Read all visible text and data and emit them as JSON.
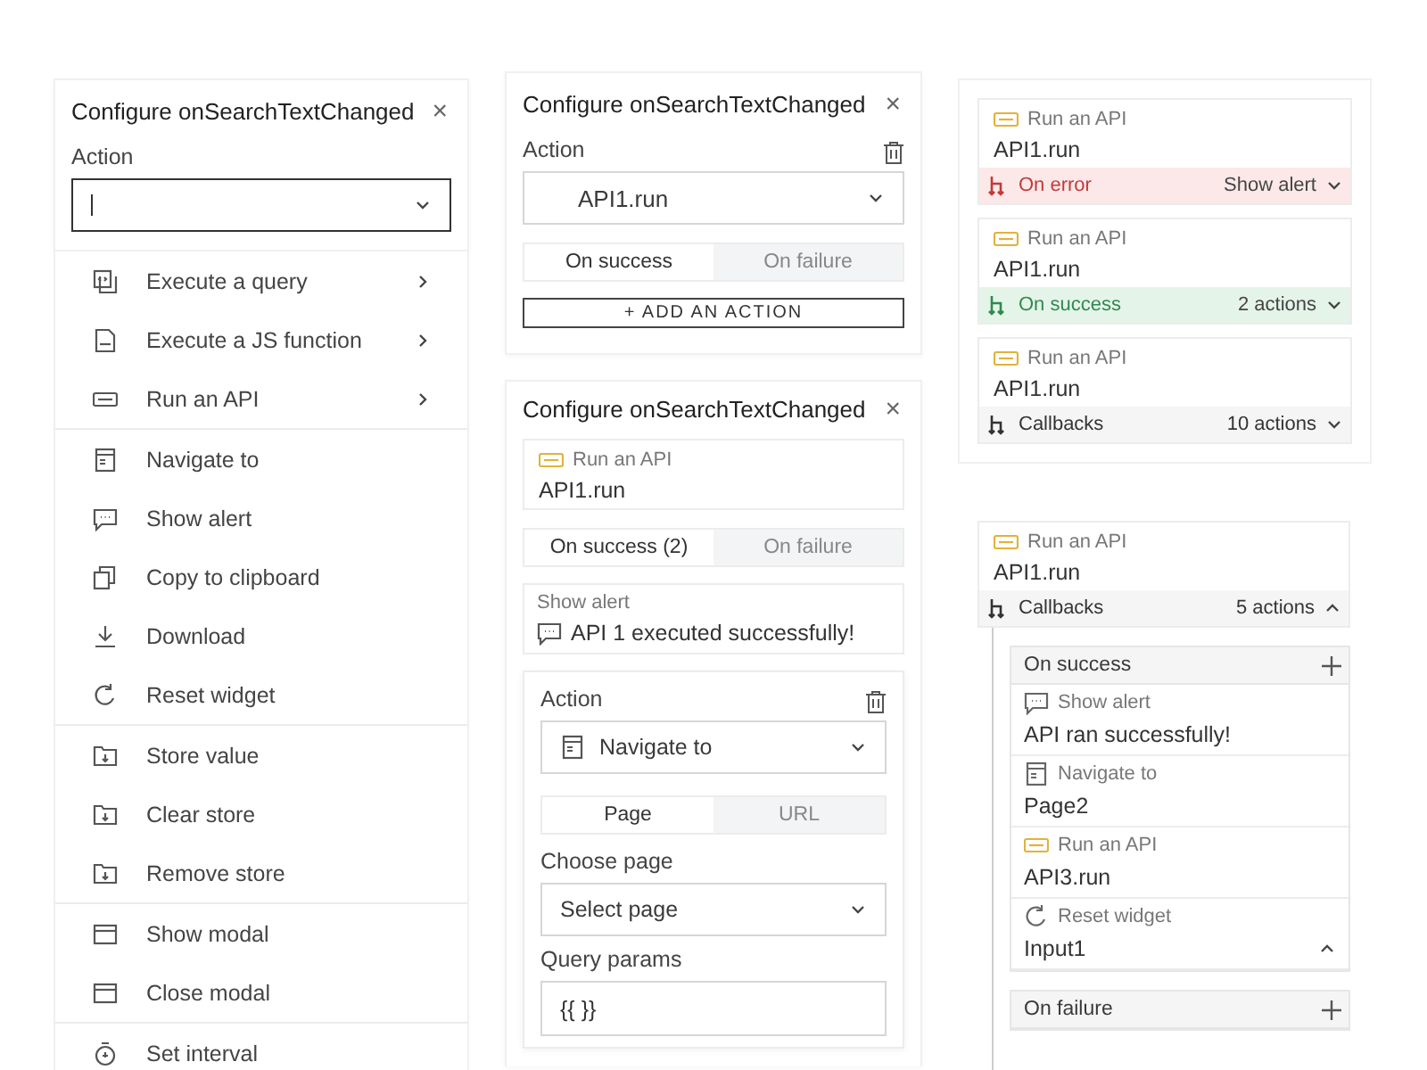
{
  "column_1": {
    "panel": {
      "title": "Configure onSearchTextChanged",
      "close": "×",
      "field_label": "Action",
      "select": {
        "focused": true
      }
    },
    "menu": {
      "groups": [
        [
          {
            "label": "Execute a query",
            "kind": "query",
            "submenu": true
          },
          {
            "label": "Execute a JS function",
            "kind": "js",
            "submenu": true
          },
          {
            "label": "Run an API",
            "kind": "api",
            "submenu": true
          }
        ],
        [
          {
            "label": "Navigate to",
            "kind": "navigate",
            "submenu": false
          },
          {
            "label": "Show alert",
            "kind": "alert",
            "submenu": false
          },
          {
            "label": "Copy to clipboard",
            "kind": "copy",
            "submenu": false
          },
          {
            "label": "Download",
            "kind": "download",
            "submenu": false
          },
          {
            "label": "Reset widget",
            "kind": "reset",
            "submenu": false
          }
        ],
        [
          {
            "label": "Store value",
            "kind": "store",
            "submenu": false
          },
          {
            "label": "Clear store",
            "kind": "store",
            "submenu": false
          },
          {
            "label": "Remove store",
            "kind": "store",
            "submenu": false
          }
        ],
        [
          {
            "label": "Show modal",
            "kind": "modal",
            "submenu": false
          },
          {
            "label": "Close modal",
            "kind": "modal",
            "submenu": false
          }
        ],
        [
          {
            "label": "Set interval",
            "kind": "interval",
            "submenu": false
          }
        ]
      ]
    }
  },
  "column_2": {
    "action_panel": {
      "title": "Configure onSearchTextChanged",
      "close": "×",
      "field_label": "Action",
      "select": {
        "value": "API1.run"
      },
      "tabs": [
        {
          "label": "On success",
          "selected": true
        },
        {
          "label": "On failure",
          "selected": false
        }
      ],
      "add_button": "+ ADD AN ACTION"
    },
    "callback_panel": {
      "title": "Configure onSearchTextChanged",
      "close": "×",
      "action": {
        "kind": "api",
        "type_label": "Run an API",
        "value": "API1.run"
      },
      "tabs": [
        {
          "label": "On success (2)",
          "selected": true
        },
        {
          "label": "On failure",
          "selected": false
        }
      ],
      "callback": {
        "kind": "alert",
        "type_label": "Show alert",
        "value": "API 1 executed successfully!"
      },
      "editor": {
        "field_label": "Action",
        "select": {
          "kind": "navigate",
          "value": "Navigate to"
        },
        "tabs": [
          {
            "label": "Page",
            "selected": true
          },
          {
            "label": "URL",
            "selected": false
          }
        ],
        "page_label": "Choose page",
        "page_select": {
          "placeholder": "Select page"
        },
        "params_label": "Query params",
        "params_input": {
          "value": "{{ }}"
        }
      }
    }
  },
  "column_3": {
    "action_cards": [
      {
        "kind": "api",
        "type_label": "Run an API",
        "value": "API1.run",
        "footer": {
          "kind": "error",
          "label": "On error",
          "summary": "Show alert",
          "expanded": false
        }
      },
      {
        "kind": "api",
        "type_label": "Run an API",
        "value": "API1.run",
        "footer": {
          "kind": "success",
          "label": "On success",
          "summary": "2 actions",
          "expanded": false
        }
      },
      {
        "kind": "api",
        "type_label": "Run an API",
        "value": "API1.run",
        "footer": {
          "kind": "callbacks",
          "label": "Callbacks",
          "summary": "10 actions",
          "expanded": false
        }
      }
    ],
    "expanded_card": {
      "kind": "api",
      "type_label": "Run an API",
      "value": "API1.run",
      "footer": {
        "kind": "callbacks",
        "label": "Callbacks",
        "summary": "5 actions",
        "expanded": true
      },
      "groups": [
        {
          "title": "On success",
          "actions": [
            {
              "kind": "alert",
              "type_label": "Show alert",
              "value": "API ran successfully!",
              "expanded": false
            },
            {
              "kind": "navigate",
              "type_label": "Navigate to",
              "value": "Page2",
              "expanded": false
            },
            {
              "kind": "api",
              "type_label": "Run an API",
              "value": "API3.run",
              "expanded": false
            },
            {
              "kind": "reset",
              "type_label": "Reset widget",
              "value": "Input1",
              "expanded": true
            }
          ]
        },
        {
          "title": "On failure"
        }
      ]
    }
  }
}
